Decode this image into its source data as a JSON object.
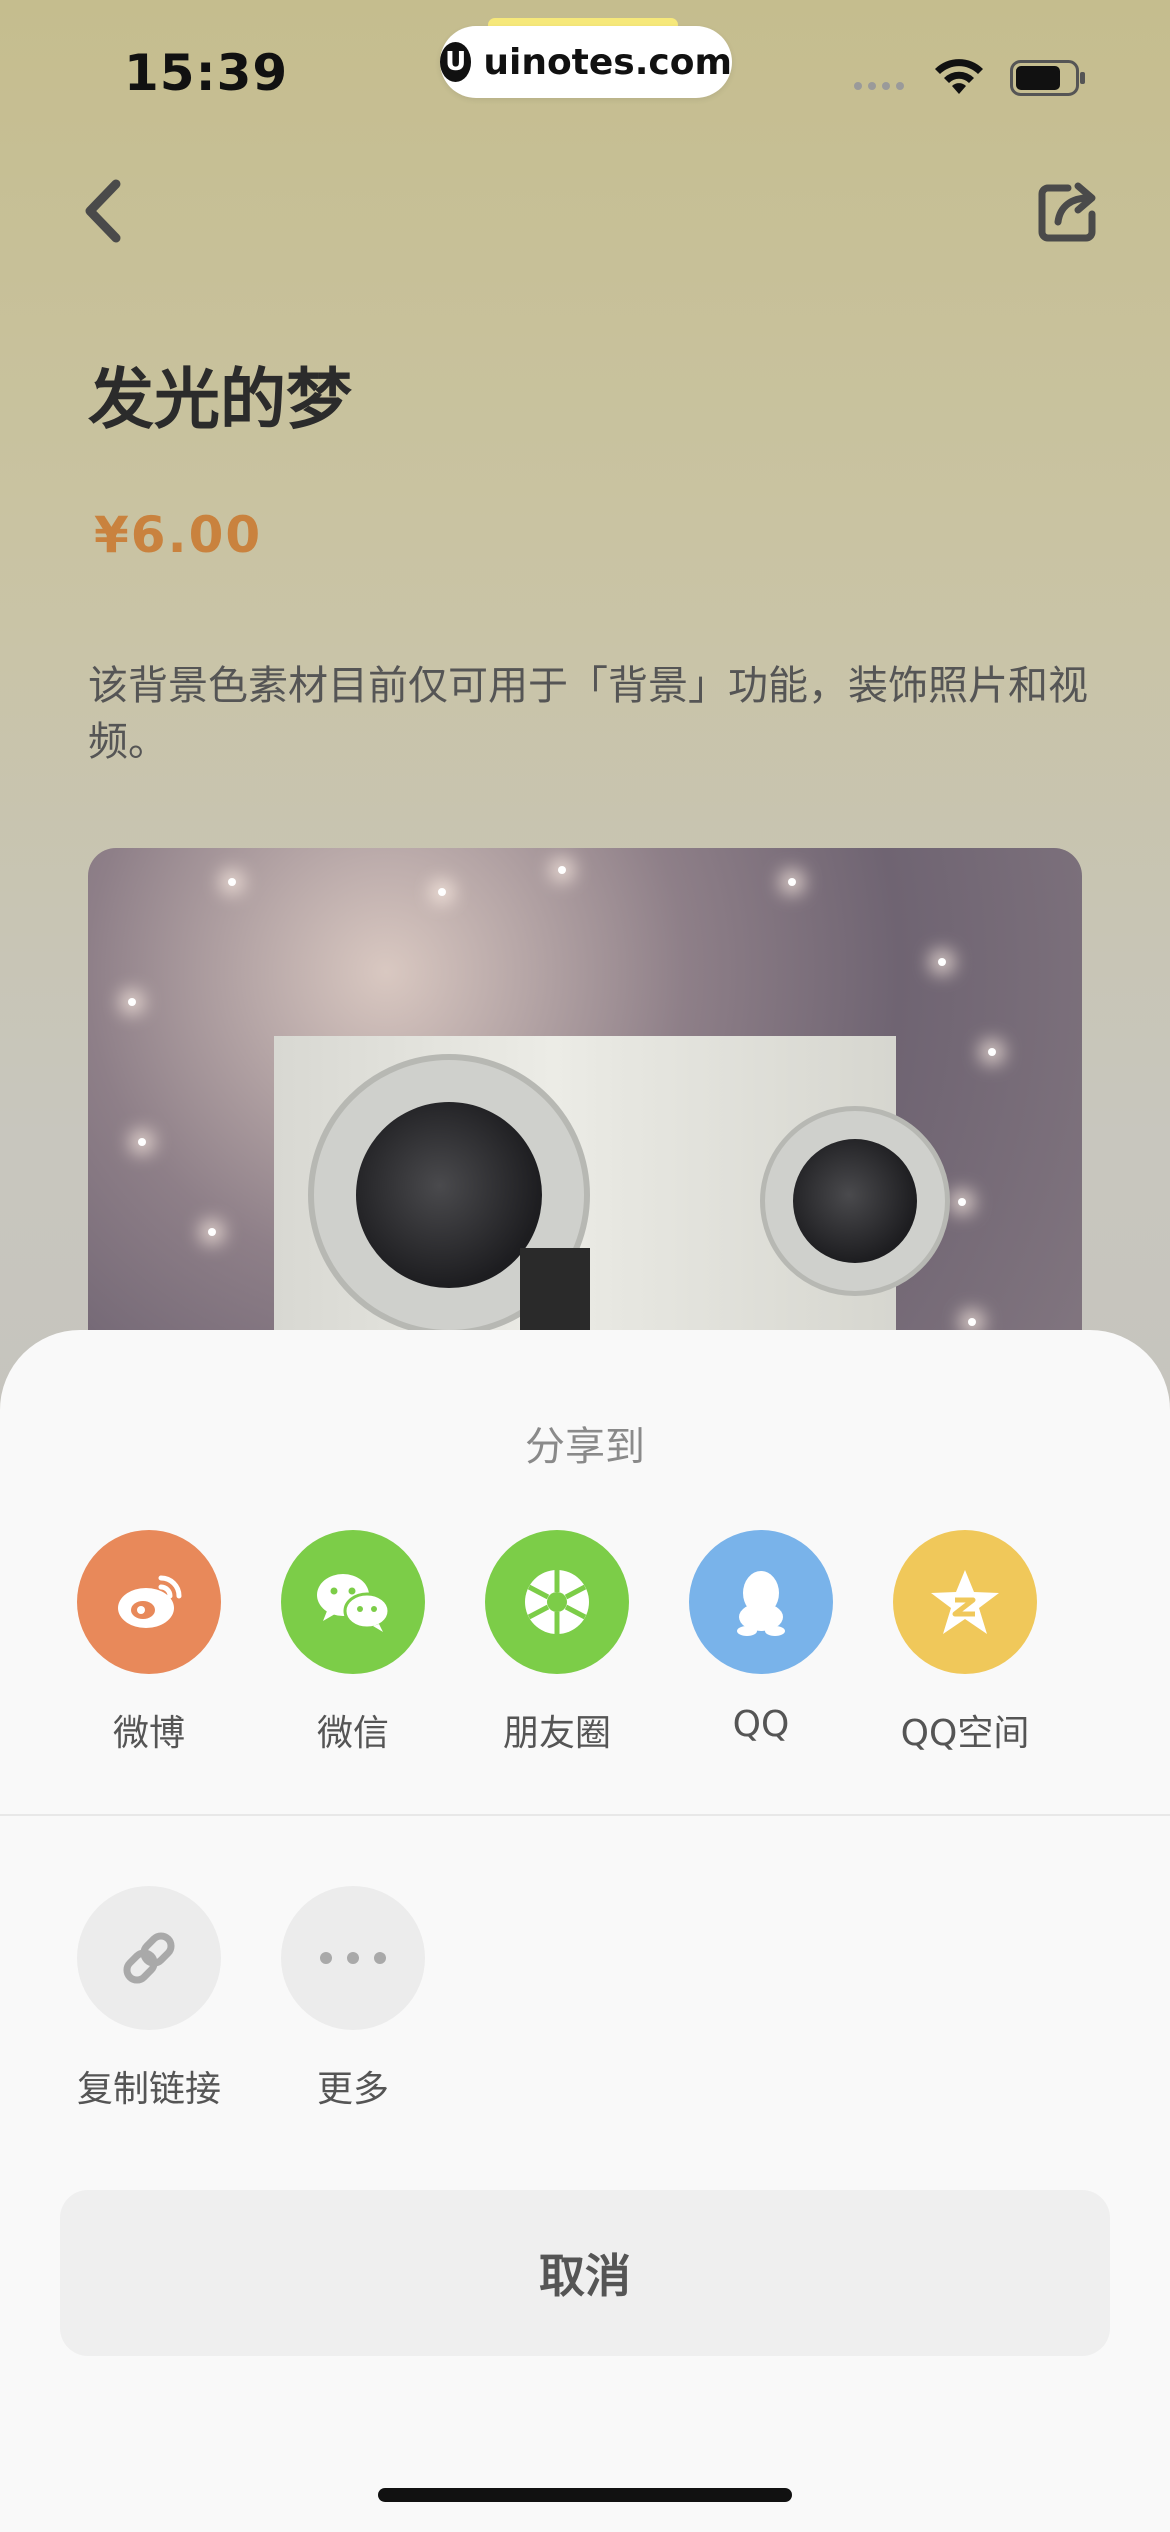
{
  "status_bar": {
    "time": "15:39",
    "site": "uinotes.com",
    "logo_letter": "U"
  },
  "header": {
    "title": "发光的梦",
    "price": "¥6.00",
    "description": "该背景色素材目前仅可用于「背景」功能，装饰照片和视频。"
  },
  "share_sheet": {
    "title": "分享到",
    "targets": [
      {
        "label": "微博",
        "icon": "weibo-icon",
        "color": "#e8895a"
      },
      {
        "label": "微信",
        "icon": "wechat-icon",
        "color": "#7ccd48"
      },
      {
        "label": "朋友圈",
        "icon": "moments-icon",
        "color": "#7ccd48"
      },
      {
        "label": "QQ",
        "icon": "qq-icon",
        "color": "#79b3ea"
      },
      {
        "label": "QQ空间",
        "icon": "qzone-icon",
        "color": "#f0c85a"
      }
    ],
    "utilities": [
      {
        "label": "复制链接",
        "icon": "link-icon"
      },
      {
        "label": "更多",
        "icon": "more-icon"
      }
    ],
    "cancel_label": "取消"
  }
}
